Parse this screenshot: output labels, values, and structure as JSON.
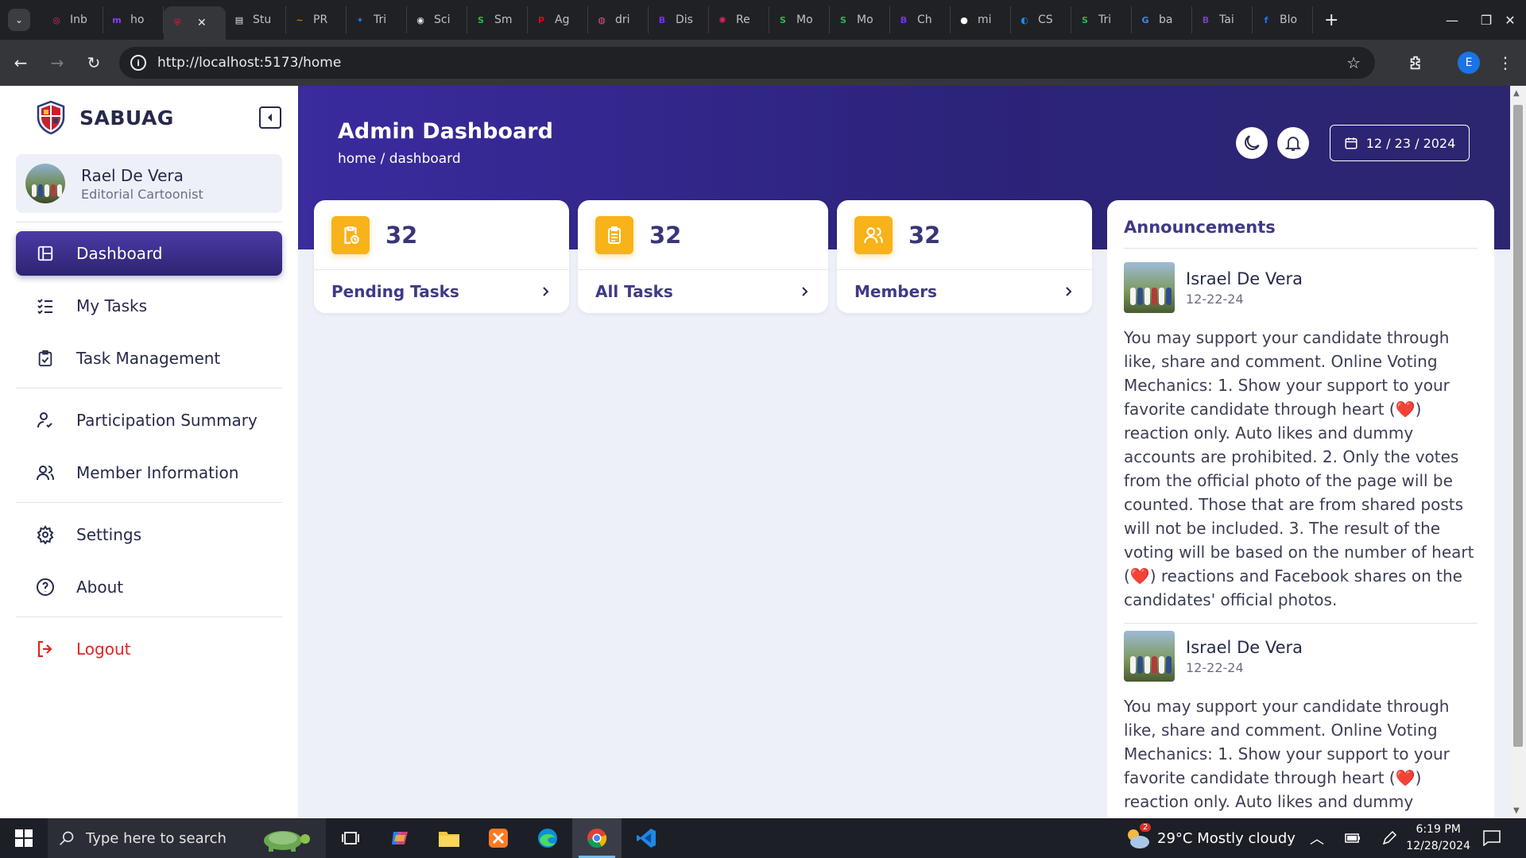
{
  "browser": {
    "tabs": [
      {
        "label": "Inb",
        "color": "#d62976",
        "glyph": "◎"
      },
      {
        "label": "ho",
        "color": "#8a3ffc",
        "glyph": "m"
      },
      {
        "label": "",
        "color": "#b11e2c",
        "glyph": "⛨",
        "active": true
      },
      {
        "label": "Stu",
        "color": "#e8eaed",
        "glyph": "▤"
      },
      {
        "label": "PR",
        "color": "#c47a00",
        "glyph": "~"
      },
      {
        "label": "Tri",
        "color": "#1a73e8",
        "glyph": "✦"
      },
      {
        "label": "Sci",
        "color": "#e8eaed",
        "glyph": "◉"
      },
      {
        "label": "Sm",
        "color": "#2dbb4e",
        "glyph": "S"
      },
      {
        "label": "Ag",
        "color": "#e60023",
        "glyph": "P"
      },
      {
        "label": "dri",
        "color": "#ea4c89",
        "glyph": "◍"
      },
      {
        "label": "Dis",
        "color": "#7b2ff7",
        "glyph": "B"
      },
      {
        "label": "Re",
        "color": "#e0245e",
        "glyph": "✺"
      },
      {
        "label": "Mo",
        "color": "#2dbb4e",
        "glyph": "S"
      },
      {
        "label": "Mo",
        "color": "#2dbb4e",
        "glyph": "S"
      },
      {
        "label": "Ch",
        "color": "#7b2ff7",
        "glyph": "B"
      },
      {
        "label": "mi",
        "color": "#ffffff",
        "glyph": "●"
      },
      {
        "label": "CS",
        "color": "#1e88e5",
        "glyph": "◐"
      },
      {
        "label": "Tri",
        "color": "#2dbb4e",
        "glyph": "S"
      },
      {
        "label": "ba",
        "color": "#4285f4",
        "glyph": "G"
      },
      {
        "label": "Tai",
        "color": "#6f42c1",
        "glyph": "B"
      },
      {
        "label": "Blo",
        "color": "#1877f2",
        "glyph": "f"
      }
    ],
    "url": "http://localhost:5173/home",
    "profile_initial": "E"
  },
  "sidebar": {
    "brand": "SABUAG",
    "user": {
      "name": "Rael De Vera",
      "role": "Editorial Cartoonist"
    },
    "items": [
      {
        "label": "Dashboard",
        "icon": "dashboard-icon"
      },
      {
        "label": "My Tasks",
        "icon": "checklist-icon"
      },
      {
        "label": "Task Management",
        "icon": "clipboard-check-icon"
      },
      {
        "label": "Participation Summary",
        "icon": "user-check-icon"
      },
      {
        "label": "Member Information",
        "icon": "users-icon"
      },
      {
        "label": "Settings",
        "icon": "gear-icon"
      },
      {
        "label": "About",
        "icon": "help-circle-icon"
      },
      {
        "label": "Logout",
        "icon": "logout-icon"
      }
    ]
  },
  "header": {
    "title": "Admin Dashboard",
    "breadcrumb": "home / dashboard",
    "date": "12 / 23 / 2024"
  },
  "stats": [
    {
      "value": "32",
      "label": "Pending Tasks",
      "icon": "clipboard-clock-icon"
    },
    {
      "value": "32",
      "label": "All Tasks",
      "icon": "clipboard-list-icon"
    },
    {
      "value": "32",
      "label": "Members",
      "icon": "users-icon"
    }
  ],
  "announcements": {
    "title": "Announcements",
    "posts": [
      {
        "author": "Israel De Vera",
        "date": "12-22-24",
        "body": "You may support your candidate through like, share and comment. Online Voting Mechanics: 1. Show your support to your favorite candidate through heart (❤️) reaction only. Auto likes and dummy accounts are prohibited. 2. Only the votes from the official photo of the page will be counted. Those that are from shared posts will not be included. 3. The result of the voting will be based on the number of heart (❤️) reactions and Facebook shares on the candidates' official photos."
      },
      {
        "author": "Israel De Vera",
        "date": "12-22-24",
        "body": "You may support your candidate through like, share and comment. Online Voting Mechanics: 1. Show your support to your favorite candidate through heart (❤️) reaction only. Auto likes and dummy accounts are prohibited."
      }
    ]
  },
  "taskbar": {
    "search_placeholder": "Type here to search",
    "weather": "29°C  Mostly cloudy",
    "weather_badge": "2",
    "time": "6:19 PM",
    "date": "12/28/2024"
  }
}
